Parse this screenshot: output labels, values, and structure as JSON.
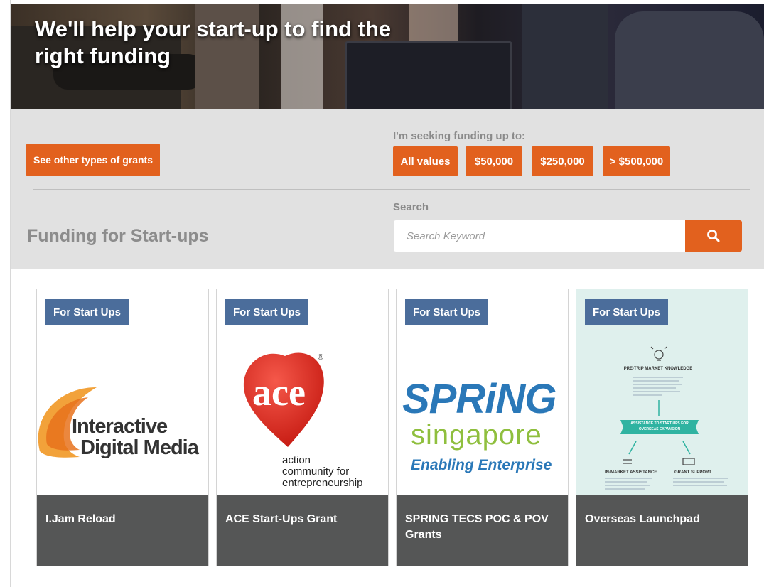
{
  "hero": {
    "title": "We'll help your start-up to find the right funding"
  },
  "filters": {
    "other_grants_label": "See other types of grants",
    "funding_label": "I'm seeking funding up to:",
    "amounts": [
      "All values",
      "$50,000",
      "$250,000",
      "> $500,000"
    ],
    "search_label": "Search",
    "search_placeholder": "Search Keyword"
  },
  "section_title": "Funding for Start-ups",
  "cards": [
    {
      "tag": "For Start Ups",
      "title": "I.Jam Reload",
      "logo": {
        "line1": "Interactive",
        "line2": "Digital Media"
      }
    },
    {
      "tag": "For Start Ups",
      "title": "ACE Start-Ups Grant",
      "logo": {
        "mark": "ace",
        "registered": "®",
        "line1": "action",
        "line2": "community for",
        "line3": "entrepreneurship"
      }
    },
    {
      "tag": "For Start Ups",
      "title": "SPRING TECS POC & POV Grants",
      "logo": {
        "line1": "SPRiNG",
        "line2": "singapore",
        "line3": "Enabling Enterprise"
      }
    },
    {
      "tag": "For Start Ups",
      "title": "Overseas Launchpad",
      "logo": {
        "heading": "PRE-TRIP MARKET KNOWLEDGE",
        "banner_line1": "ASSISTANCE TO START-UPS FOR",
        "banner_line2": "OVERSEAS EXPANSION",
        "left_heading": "IN-MARKET ASSISTANCE",
        "right_heading": "GRANT SUPPORT"
      }
    }
  ],
  "colors": {
    "accent": "#e2611e",
    "tag": "#4b6d9b",
    "footer": "#555656",
    "panel": "#e1e1e1",
    "ace_red": "#e0251b",
    "spring_blue": "#2a78b8",
    "spring_green": "#8fbf3e",
    "launchpad_bg": "#dff0ed",
    "launchpad_teal": "#2fb3a1"
  }
}
